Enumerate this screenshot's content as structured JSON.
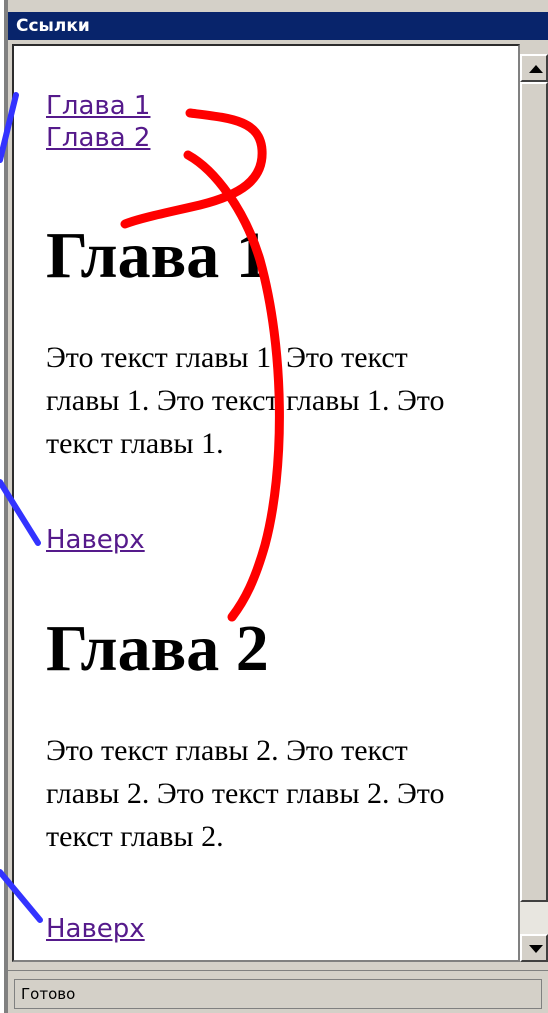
{
  "window": {
    "title": "Ссылки",
    "status": "Готово"
  },
  "toc": {
    "link1": "Глава 1",
    "link2": "Глава 2"
  },
  "chapters": [
    {
      "heading": "Глава 1",
      "text": "Это текст главы 1. Это текст главы 1. Это текст главы 1. Это текст главы 1.",
      "top_link": "Наверх"
    },
    {
      "heading": "Глава 2",
      "text": "Это текст главы 2. Это текст главы 2. Это текст главы 2. Это текст главы 2.",
      "top_link": "Наверх"
    }
  ],
  "colors": {
    "titlebar": "#08246b",
    "link": "#551a8b",
    "red_annotation": "#ff0000",
    "blue_annotation": "#3333ff"
  },
  "icons": {
    "scroll_up": "arrow-up-icon",
    "scroll_down": "arrow-down-icon"
  }
}
